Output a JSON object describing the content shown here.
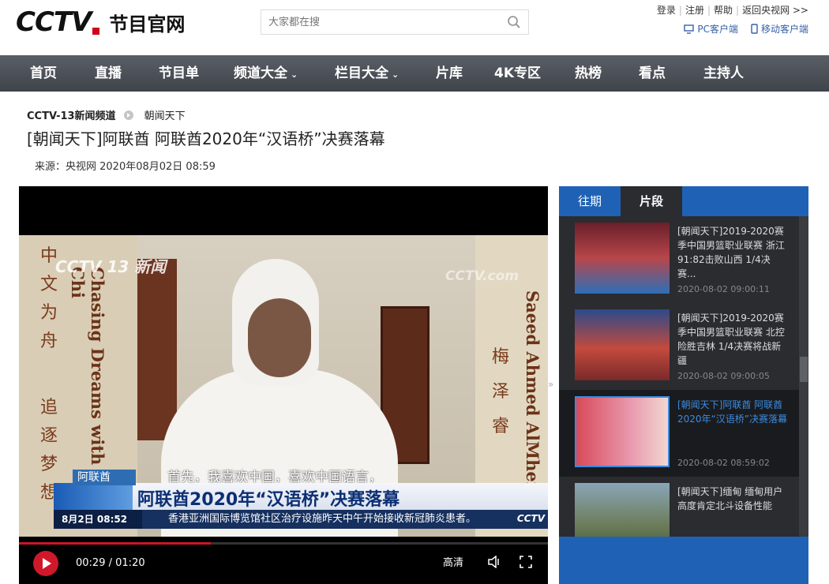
{
  "header": {
    "logo_text": "CCTV",
    "logo_sub": "节目官网",
    "search_placeholder": "大家都在搜",
    "top_links": [
      "登录",
      "注册",
      "帮助",
      "返回央视网 >>"
    ],
    "client_links": [
      "PC客户端",
      "移动客户端"
    ]
  },
  "nav": {
    "items": [
      {
        "label": "首页"
      },
      {
        "label": "直播"
      },
      {
        "label": "节目单"
      },
      {
        "label": "频道大全",
        "dropdown": true
      },
      {
        "label": "栏目大全",
        "dropdown": true
      },
      {
        "label": "片库"
      },
      {
        "label": "4K专区"
      },
      {
        "label": "热榜"
      },
      {
        "label": "看点"
      },
      {
        "label": "主持人"
      }
    ],
    "dropdown_glyph": "⌄"
  },
  "breadcrumb": {
    "channel": "CCTV-13新闻频道",
    "column": "朝闻天下"
  },
  "article": {
    "title": "[朝闻天下]阿联酋 阿联酋2020年“汉语桥”决赛落幕",
    "meta": "来源：央视网 2020年08月02日 08:59"
  },
  "video": {
    "watermark": "CCTV 13 新闻",
    "watermark2": "CCTV.com",
    "left_chars": [
      "中",
      "文",
      "为",
      "舟",
      "追",
      "逐",
      "梦",
      "想"
    ],
    "left_en": "Chasing Dreams with Chi",
    "right_chars": [
      "梅",
      "泽",
      "睿"
    ],
    "right_en": "Saeed Ahmed AlMheiri",
    "subtitle": "首先，我喜欢中国，喜欢中国语言，",
    "lower_tag": "阿联酋",
    "lower_title": "阿联酋2020年“汉语桥”决赛落幕",
    "ticker_date": "8月2日  08:52",
    "ticker_text": "香港亚洲国际博览馆社区治疗设施昨天中午开始接收新冠肺炎患者。",
    "ticker_logo": "CCTV"
  },
  "player": {
    "current_time": "00:29",
    "separator": "/",
    "duration": "01:20",
    "quality": "高清",
    "progress_fraction": 0.3625
  },
  "sidebar": {
    "tabs": [
      {
        "label": "往期",
        "active": false
      },
      {
        "label": "片段",
        "active": true
      }
    ],
    "collapse_glyph": "»",
    "items": [
      {
        "title": "[朝闻天下]2019-2020赛季中国男篮职业联赛 浙江91:82击败山西 1/4决赛...",
        "time": "2020-08-02 09:00:11",
        "active": false
      },
      {
        "title": "[朝闻天下]2019-2020赛季中国男篮职业联赛 北控险胜吉林 1/4决赛将战新疆",
        "time": "2020-08-02 09:00:05",
        "active": false
      },
      {
        "title": "[朝闻天下]阿联酋 阿联酋2020年“汉语桥”决赛落幕",
        "time": "2020-08-02 08:59:02",
        "active": true
      },
      {
        "title": "[朝闻天下]缅甸 缅甸用户高度肯定北斗设备性能",
        "time": "",
        "active": false
      }
    ]
  },
  "colors": {
    "nav_bg": "#4a4e55",
    "brand_red": "#d0021b",
    "sidebar_blue": "#1f62b5",
    "active_blue": "#3a8be0"
  }
}
